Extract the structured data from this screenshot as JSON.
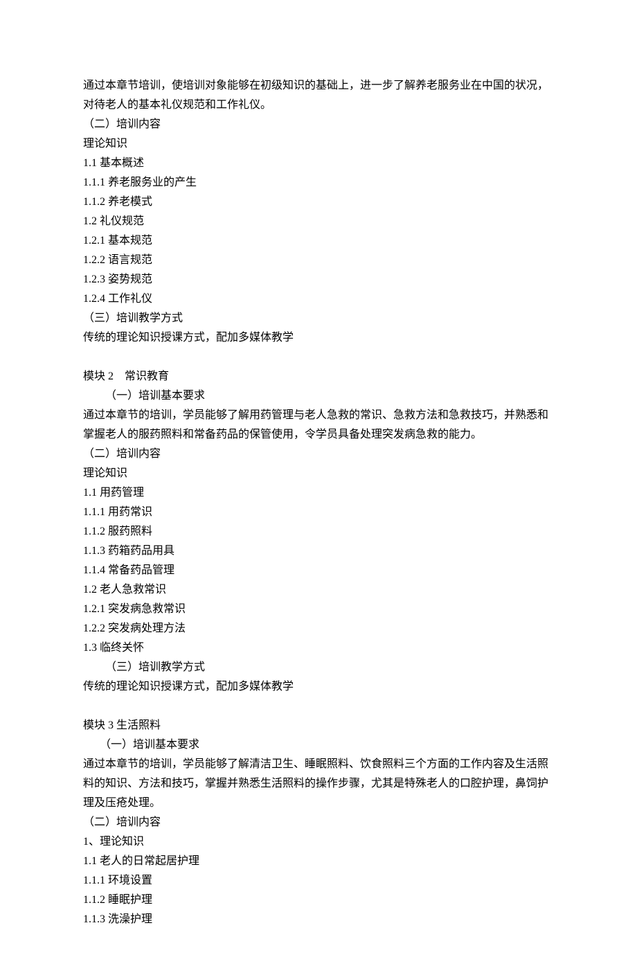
{
  "intro": {
    "p1": "通过本章节培训，使培训对象能够在初级知识的基础上，进一步了解养老服务业在中国的状况，对待老人的基本礼仪规范和工作礼仪。",
    "h2": "（二）培训内容",
    "h2_sub": "理论知识",
    "i11": "1.1 基本概述",
    "i111": "1.1.1 养老服务业的产生",
    "i112": "1.1.2 养老模式",
    "i12": "1.2 礼仪规范",
    "i121": "1.2.1 基本规范",
    "i122": "1.2.2 语言规范",
    "i123": "1.2.3 姿势规范",
    "i124": "1.2.4 工作礼仪",
    "h3": "（三）培训教学方式",
    "h3_p": "传统的理论知识授课方式，配加多媒体教学"
  },
  "mod2": {
    "title": "模块 2　常识教育",
    "h1": "（一）培训基本要求",
    "h1_p": "通过本章节的培训，学员能够了解用药管理与老人急救的常识、急救方法和急救技巧，并熟悉和掌握老人的服药照料和常备药品的保管使用，令学员具备处理突发病急救的能力。",
    "h2": "（二）培训内容",
    "h2_sub": "理论知识",
    "i11": "1.1 用药管理",
    "i111": "1.1.1 用药常识",
    "i112": "1.1.2 服药照料",
    "i113": "1.1.3 药箱药品用具",
    "i114": "1.1.4 常备药品管理",
    "i12": "1.2 老人急救常识",
    "i121": "1.2.1 突发病急救常识",
    "i122": "1.2.2 突发病处理方法",
    "i13": "1.3 临终关怀",
    "h3": "（三）培训教学方式",
    "h3_p": "传统的理论知识授课方式，配加多媒体教学"
  },
  "mod3": {
    "title": "模块 3  生活照料",
    "h1": "（一）培训基本要求",
    "h1_p": "通过本章节的培训，学员能够了解清洁卫生、睡眠照料、饮食照料三个方面的工作内容及生活照料的知识、方法和技巧，掌握并熟悉生活照料的操作步骤，尤其是特殊老人的口腔护理，鼻饲护理及压疮处理。",
    "h2": "（二）培训内容",
    "h2_sub": "1、理论知识",
    "i11": "1.1 老人的日常起居护理",
    "i111": "1.1.1 环境设置",
    "i112": "1.1.2 睡眠护理",
    "i113": "1.1.3 洗澡护理"
  }
}
